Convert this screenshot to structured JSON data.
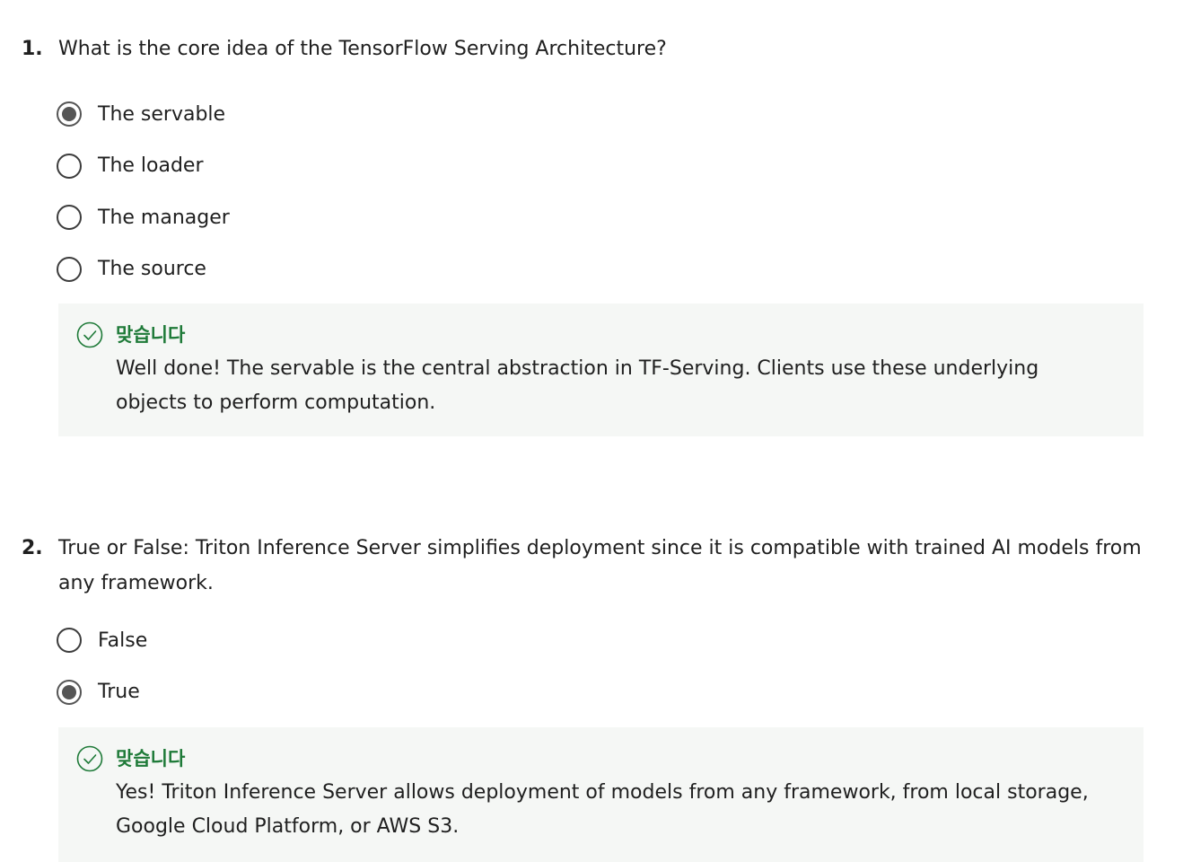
{
  "questions": [
    {
      "number": "1.",
      "text": "What is the core idea of the TensorFlow Serving Architecture?",
      "options": [
        {
          "label": "The servable",
          "selected": true
        },
        {
          "label": "The loader",
          "selected": false
        },
        {
          "label": "The manager",
          "selected": false
        },
        {
          "label": "The source",
          "selected": false
        }
      ],
      "feedback": {
        "icon": "check-circle-icon",
        "title": "맞습니다",
        "text": "Well done! The servable is the central abstraction in TF-Serving. Clients use these underlying objects to perform computation."
      }
    },
    {
      "number": "2.",
      "text": "True or False: Triton Inference Server simplifies deployment since it is compatible with trained AI models from any framework.",
      "options": [
        {
          "label": "False",
          "selected": false
        },
        {
          "label": "True",
          "selected": true
        }
      ],
      "feedback": {
        "icon": "check-circle-icon",
        "title": "맞습니다",
        "text": "Yes! Triton Inference Server allows deployment of models from any framework, from local storage, Google Cloud Platform, or AWS S3."
      }
    }
  ],
  "colors": {
    "correct_green": "#1e7a38",
    "feedback_bg": "#f5f7f5",
    "radio_fill": "#555555"
  }
}
